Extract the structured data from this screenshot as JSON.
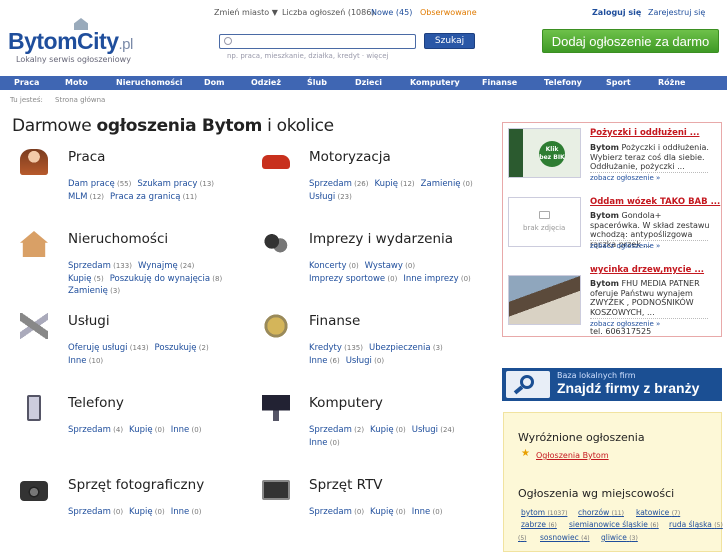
{
  "header": {
    "logo": "BytomCity",
    "logo_suffix": ".pl",
    "tagline": "Lokalny serwis ogłoszeniowy",
    "change_city": "Zmień miasto ▼",
    "ads_count": "Liczba ogłoszeń (1086)",
    "new": "Nowe (45)",
    "watched": "Obserwowane",
    "login": "Zaloguj się",
    "register": "Zarejestruj się",
    "search_placeholder": "",
    "search_hint": "np. praca, mieszkanie, działka, kredyt · więcej",
    "search_button": "Szukaj",
    "add_button": "Dodaj ogłoszenie za darmo"
  },
  "nav": [
    "Praca",
    "Moto",
    "Nieruchomości",
    "Dom",
    "Odzież",
    "Ślub",
    "Dzieci",
    "Komputery",
    "Finanse",
    "Telefony",
    "Sport",
    "Różne"
  ],
  "breadcrumb": {
    "label": "Tu jesteś:",
    "current": "Strona główna"
  },
  "title": {
    "a": "Darmowe ",
    "b": "ogłoszenia Bytom",
    "c": " i okolice"
  },
  "categories": [
    {
      "title": "Praca",
      "icon": "woman-icon",
      "subs": [
        [
          "Dam pracę",
          "55"
        ],
        [
          "Szukam pracy",
          "13"
        ],
        [
          "MLM",
          "12"
        ],
        [
          "Praca za granicą",
          "11"
        ]
      ]
    },
    {
      "title": "Motoryzacja",
      "icon": "car-icon",
      "subs": [
        [
          "Sprzedam",
          "26"
        ],
        [
          "Kupię",
          "12"
        ],
        [
          "Zamienię",
          "0"
        ],
        [
          "Usługi",
          "23"
        ]
      ]
    },
    {
      "title": "Nieruchomości",
      "icon": "house-icon",
      "subs": [
        [
          "Sprzedam",
          "133"
        ],
        [
          "Wynajmę",
          "24"
        ],
        [
          "Kupię",
          "5"
        ],
        [
          "Poszukuję do wynajęcia",
          "8"
        ],
        [
          "Zamienię",
          "3"
        ]
      ]
    },
    {
      "title": "Imprezy i wydarzenia",
      "icon": "masks-icon",
      "subs": [
        [
          "Koncerty",
          "0"
        ],
        [
          "Wystawy",
          "0"
        ],
        [
          "Imprezy sportowe",
          "0"
        ],
        [
          "Inne imprezy",
          "0"
        ]
      ]
    },
    {
      "title": "Usługi",
      "icon": "tools-icon",
      "subs": [
        [
          "Oferuję usługi",
          "143"
        ],
        [
          "Poszukuję",
          "2"
        ],
        [
          "Inne",
          "10"
        ]
      ]
    },
    {
      "title": "Finanse",
      "icon": "coin-icon",
      "subs": [
        [
          "Kredyty",
          "135"
        ],
        [
          "Ubezpieczenia",
          "3"
        ],
        [
          "Inne",
          "6"
        ],
        [
          "Usługi",
          "0"
        ]
      ]
    },
    {
      "title": "Telefony",
      "icon": "phone-icon",
      "subs": [
        [
          "Sprzedam",
          "4"
        ],
        [
          "Kupię",
          "0"
        ],
        [
          "Inne",
          "0"
        ]
      ]
    },
    {
      "title": "Komputery",
      "icon": "computer-icon",
      "subs": [
        [
          "Sprzedam",
          "2"
        ],
        [
          "Kupię",
          "0"
        ],
        [
          "Usługi",
          "24"
        ],
        [
          "Inne",
          "0"
        ]
      ]
    },
    {
      "title": "Sprzęt fotograficzny",
      "icon": "camera-icon",
      "subs": [
        [
          "Sprzedam",
          "0"
        ],
        [
          "Kupię",
          "0"
        ],
        [
          "Inne",
          "0"
        ]
      ]
    },
    {
      "title": "Sprzęt RTV",
      "icon": "tv-icon",
      "subs": [
        [
          "Sprzedam",
          "0"
        ],
        [
          "Kupię",
          "0"
        ],
        [
          "Inne",
          "0"
        ]
      ]
    }
  ],
  "ads": [
    {
      "title": "Pożyczki i oddłużeni ...",
      "city": "Bytom",
      "text": "Pożyczki i oddłużenia. Wybierz teraz coś dla siebie. Oddłużanie, pożyczki ...",
      "link": "zobacz ogłoszenie »",
      "thumb": "Klik bez BIK"
    },
    {
      "title": "Oddam wózek TAKO BAB ...",
      "city": "Bytom",
      "text": "Gondola+ spacerówka. W skład zestawu wchodzą: antypoślizgowa rączka przek ...",
      "link": "zobacz ogłoszenie »",
      "thumb": "brak zdjęcia"
    },
    {
      "title": "wycinka drzew,mycie ...",
      "city": "Bytom",
      "text": "FHU MEDIA PATNER oferuje Państwu wynajem ZWYŻEK , PODNOŚNIKÓW KOSZOWYCH, ...",
      "link": "zobacz ogłoszenie »",
      "extra": "tel. 606317525",
      "thumb": ""
    }
  ],
  "firmy": {
    "small": "Baza lokalnych firm",
    "big": "Znajdź firmy z branży"
  },
  "featured": {
    "heading": "Wyróżnione ogłoszenia",
    "link": "Ogłoszenia Bytom"
  },
  "cities": {
    "heading": "Ogłoszenia wg miejscowości",
    "list": [
      [
        "bytom",
        "1037"
      ],
      [
        "chorzów",
        "11"
      ],
      [
        "katowice",
        "7"
      ],
      [
        "zabrze",
        "6"
      ],
      [
        "siemianowice śląskie",
        "6"
      ],
      [
        "ruda śląska",
        "5"
      ],
      [
        "sosnowiec",
        "4"
      ],
      [
        "gliwice",
        "3"
      ]
    ]
  },
  "colors": {
    "accent": "#1f4e9c",
    "nav": "#3f66b3",
    "green": "#4caf2e",
    "adred": "#c4181f",
    "yellow": "#fdf8d7"
  }
}
